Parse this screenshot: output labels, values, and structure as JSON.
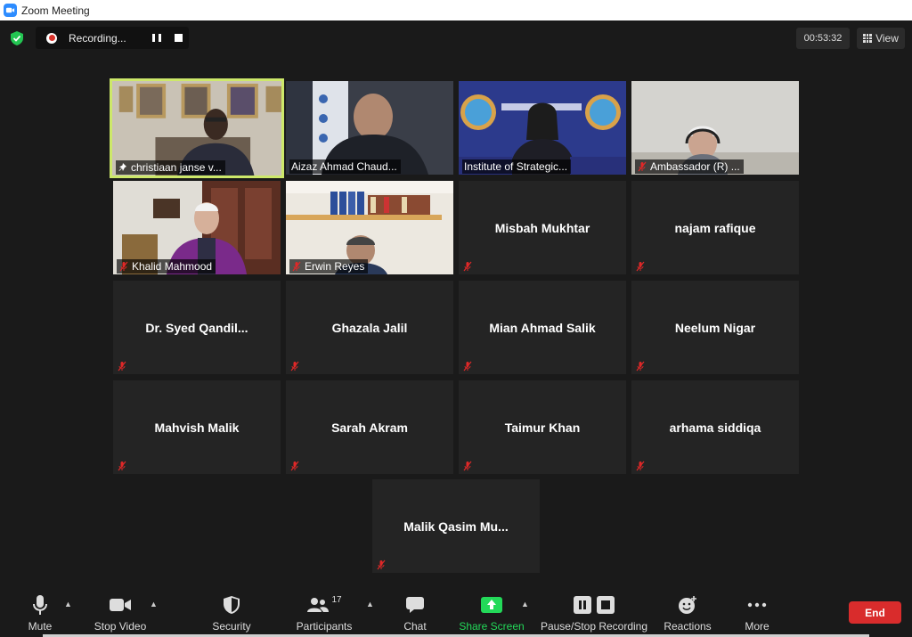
{
  "window": {
    "title": "Zoom Meeting"
  },
  "topbar": {
    "recording_label": "Recording...",
    "timer": "00:53:32",
    "view_label": "View"
  },
  "tiles": [
    {
      "name": "christiaan janse v...",
      "video": true,
      "pinned": true,
      "active": true
    },
    {
      "name": "Aizaz Ahmad Chaud...",
      "video": true
    },
    {
      "name": "Institute of Strategic...",
      "video": true
    },
    {
      "name": "Ambassador (R) ...",
      "video": true,
      "muted": true
    },
    {
      "name": "Khalid Mahmood",
      "video": true,
      "muted": true
    },
    {
      "name": "Erwin Reyes",
      "video": true,
      "muted": true
    },
    {
      "name": "Misbah Mukhtar",
      "muted": true
    },
    {
      "name": "najam rafique",
      "muted": true
    },
    {
      "name": "Dr. Syed Qandil...",
      "muted": true
    },
    {
      "name": "Ghazala Jalil",
      "muted": true
    },
    {
      "name": "Mian Ahmad Salik",
      "muted": true
    },
    {
      "name": "Neelum Nigar",
      "muted": true
    },
    {
      "name": "Mahvish Malik",
      "muted": true
    },
    {
      "name": "Sarah Akram",
      "muted": true
    },
    {
      "name": "Taimur Khan",
      "muted": true
    },
    {
      "name": "arhama siddiqa",
      "muted": true
    },
    {
      "name": "Malik Qasim Mu...",
      "muted": true
    }
  ],
  "toolbar": {
    "mute": "Mute",
    "stop_video": "Stop Video",
    "security": "Security",
    "participants": "Participants",
    "participants_count": "17",
    "chat": "Chat",
    "share_screen": "Share Screen",
    "pause_stop_recording": "Pause/Stop Recording",
    "reactions": "Reactions",
    "more": "More",
    "end": "End"
  },
  "colors": {
    "active_speaker": "#cde86a",
    "share_green": "#23d959",
    "end_red": "#d92c2c",
    "muted_red": "#e02828"
  }
}
